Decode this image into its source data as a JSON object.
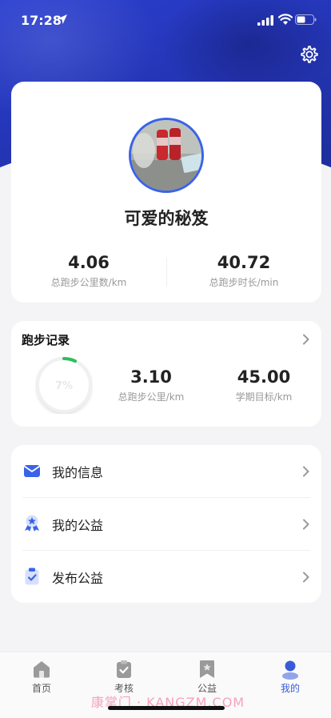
{
  "status": {
    "time": "17:28"
  },
  "profile": {
    "name": "可爱的秘笈",
    "stats": [
      {
        "value": "4.06",
        "label": "总跑步公里数/km"
      },
      {
        "value": "40.72",
        "label": "总跑步时长/min"
      }
    ]
  },
  "run_record": {
    "title": "跑步记录",
    "progress_percent": 7,
    "progress_label": "7%",
    "stats": [
      {
        "value": "3.10",
        "label": "总跑步公里/km"
      },
      {
        "value": "45.00",
        "label": "学期目标/km"
      }
    ]
  },
  "menu": [
    {
      "label": "我的信息",
      "icon": "envelope-icon"
    },
    {
      "label": "我的公益",
      "icon": "award-icon"
    },
    {
      "label": "发布公益",
      "icon": "clipboard-check-icon"
    }
  ],
  "tabs": [
    {
      "label": "首页",
      "icon": "home-icon"
    },
    {
      "label": "考核",
      "icon": "clipboard-icon"
    },
    {
      "label": "公益",
      "icon": "bookmark-star-icon"
    },
    {
      "label": "我的",
      "icon": "person-icon",
      "active": true
    }
  ],
  "watermark": "康掌门 · KANGZM.COM",
  "colors": {
    "accent": "#3a5bd9",
    "progress": "#2bbf5a",
    "hero": "#2435b5"
  }
}
